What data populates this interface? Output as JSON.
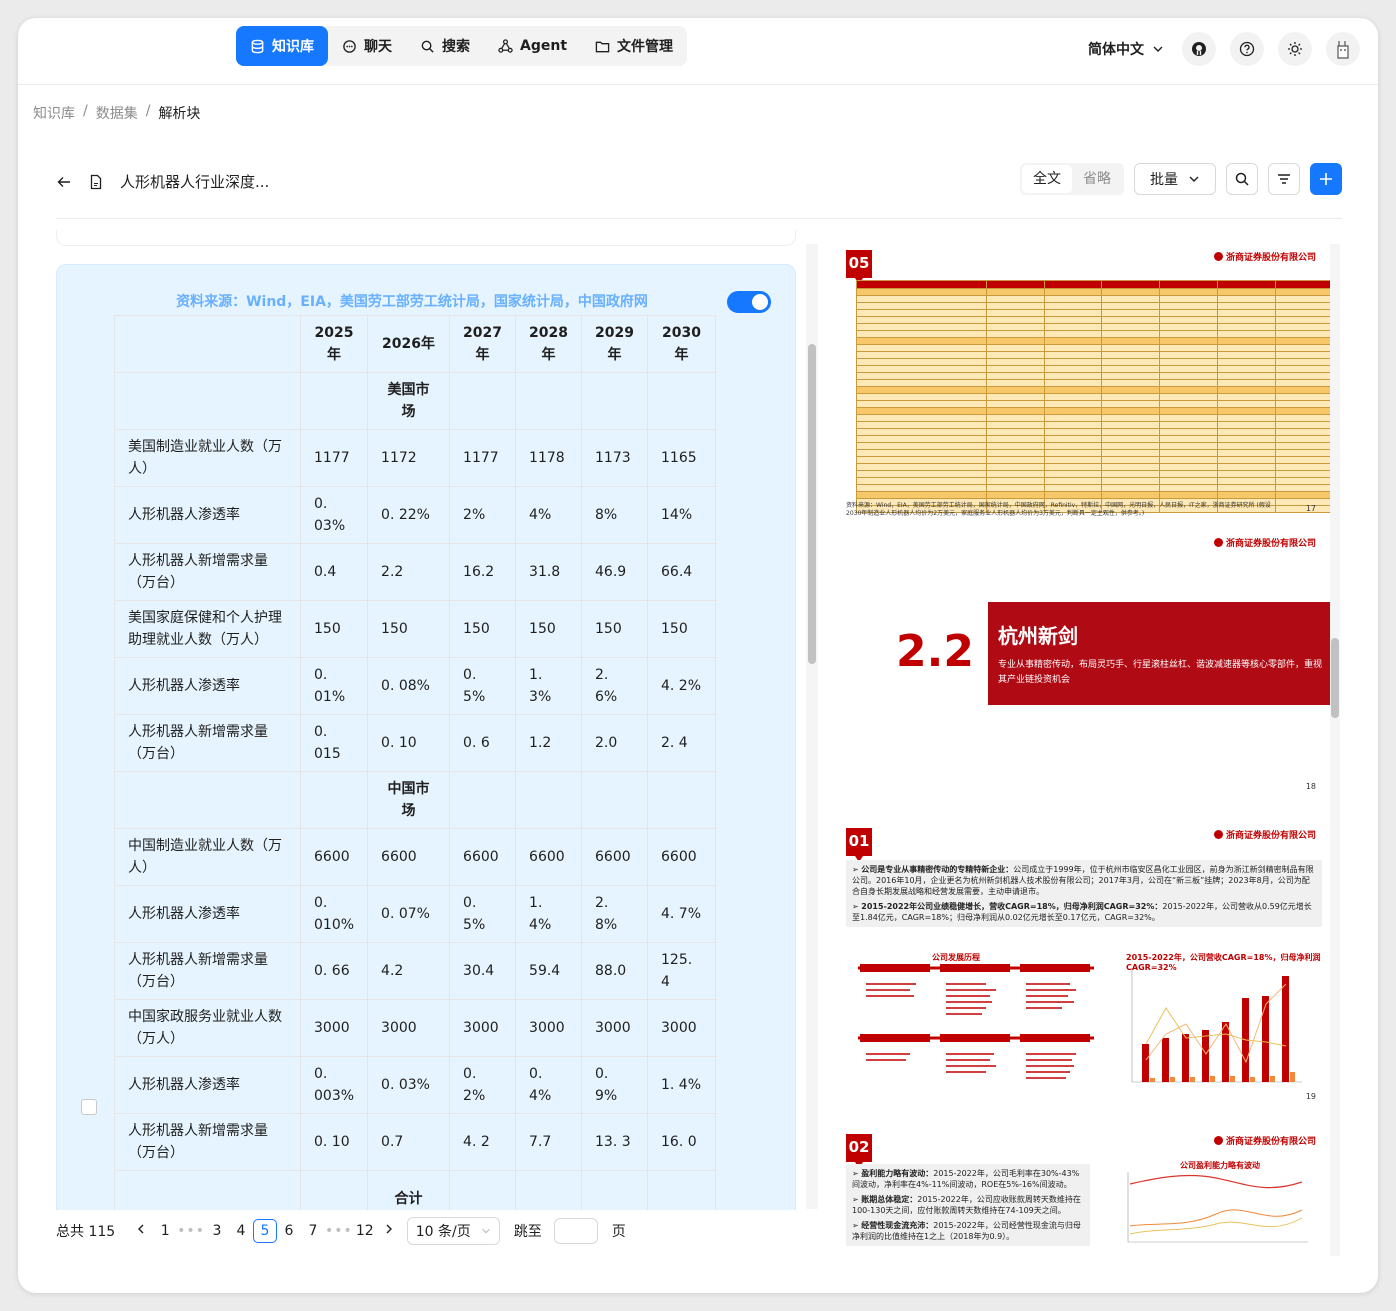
{
  "nav": {
    "items": [
      {
        "label": "知识库",
        "icon": "database-icon",
        "active": true
      },
      {
        "label": "聊天",
        "icon": "chat-icon",
        "active": false
      },
      {
        "label": "搜索",
        "icon": "search-icon",
        "active": false
      },
      {
        "label": "Agent",
        "icon": "agent-graph-icon",
        "active": false
      },
      {
        "label": "文件管理",
        "icon": "folder-icon",
        "active": false
      }
    ],
    "language": "简体中文"
  },
  "breadcrumb": [
    "知识库",
    "数据集",
    "解析块"
  ],
  "doc": {
    "title": "人形机器人行业深度...",
    "view_full": "全文",
    "view_brief": "省略",
    "batch_label": "批量"
  },
  "chunk": {
    "source": "资料来源：Wind，EIA，美国劳工部劳工统计局，国家统计局，中国政府网",
    "enabled": true,
    "headers": [
      "",
      "2025年",
      "2026年",
      "2027年",
      "2028年",
      "2029年",
      "2030年"
    ],
    "rows": [
      {
        "section": "美国市场"
      },
      {
        "cells": [
          "美国制造业就业人数（万人）",
          "1177",
          "1172",
          "1177",
          "1178",
          "1173",
          "1165"
        ]
      },
      {
        "cells": [
          "人形机器人渗透率",
          "0. 03%",
          "0. 22%",
          "2%",
          "4%",
          "8%",
          "14%"
        ]
      },
      {
        "cells": [
          "人形机器人新增需求量（万台）",
          "0.4",
          "2.2",
          "16.2",
          "31.8",
          "46.9",
          "66.4"
        ]
      },
      {
        "cells": [
          "美国家庭保健和个人护理助理就业人数（万人）",
          "150",
          "150",
          "150",
          "150",
          "150",
          "150"
        ]
      },
      {
        "cells": [
          "人形机器人渗透率",
          "0. 01%",
          "0. 08%",
          "0. 5%",
          "1. 3%",
          "2. 6%",
          "4. 2%"
        ]
      },
      {
        "cells": [
          "人形机器人新增需求量（万台）",
          "0. 015",
          "0. 10",
          "0. 6",
          "1.2",
          "2.0",
          "2. 4"
        ]
      },
      {
        "section": "中国市场"
      },
      {
        "cells": [
          "中国制造业就业人数（万人）",
          "6600",
          "6600",
          "6600",
          "6600",
          "6600",
          "6600"
        ]
      },
      {
        "cells": [
          "人形机器人渗透率",
          "0. 010%",
          "0. 07%",
          "0. 5%",
          "1. 4%",
          "2. 8%",
          "4. 7%"
        ]
      },
      {
        "cells": [
          "人形机器人新增需求量（万台）",
          "0. 66",
          "4.2",
          "30.4",
          "59.4",
          "88.0",
          "125. 4"
        ]
      },
      {
        "cells": [
          "中国家政服务业就业人数（万人）",
          "3000",
          "3000",
          "3000",
          "3000",
          "3000",
          "3000"
        ]
      },
      {
        "cells": [
          "人形机器人渗透率",
          "0. 003%",
          "0. 03%",
          "0. 2%",
          "0. 4%",
          "0. 9%",
          "1. 4%"
        ]
      },
      {
        "cells": [
          "人形机器人新增需求量（万台）",
          "0. 10",
          "0.7",
          "4. 2",
          "7.7",
          "13. 3",
          "16. 0"
        ]
      },
      {
        "section": "合计"
      }
    ]
  },
  "pagination": {
    "total": "总共 115",
    "pages": [
      "1",
      "•••",
      "3",
      "4",
      "5",
      "6",
      "7",
      "•••",
      "12"
    ],
    "current": "5",
    "page_size": "10 条/页",
    "jump_label": "跳至",
    "page_suffix": "页"
  },
  "pdf": {
    "brand": "浙商证券股份有限公司",
    "page17": {
      "num": "05",
      "footer": "17",
      "note": "资料来源：Wind，EIA，美国劳工部劳工统计局，国家统计局，中国政府网，Refinitiv，特斯拉，中国网，光明日报，人民日报，IT之家，浙商证券研究所 (假设2030年制造业人形机器人均价为2万美元，家庭服务业人形机器人均价为3万美元，判断具一定主观性，供参考。)"
    },
    "page18": {
      "sec": "2.2",
      "title": "杭州新剑",
      "desc": "专业从事精密传动，布局灵巧手、行星滚柱丝杠、谐波减速器等核心零部件，重视其产业链投资机会",
      "footer": "18"
    },
    "page19": {
      "num": "01",
      "footer": "19",
      "p1_bold": "公司是专业从事精密传动的专精特新企业：",
      "p1": "公司成立于1999年，位于杭州市临安区昌化工业园区，前身为浙江新剑精密制品有限公司。2016年10月，企业更名为杭州新剑机器人技术股份有限公司；2017年3月，公司在“新三板”挂牌；2023年8月，公司为配合自身长期发展战略和经营发展需要，主动申请退市。",
      "p2_bold": "2015-2022年公司业绩稳健增长，营收CAGR=18%，归母净利润CAGR=32%：",
      "p2": "2015-2022年，公司营收从0.59亿元增长至1.84亿元，CAGR=18%；归母净利润从0.02亿元增长至0.17亿元，CAGR=32%。",
      "chart1_title": "公司发展历程",
      "chart2_title": "2015-2022年，公司营收CAGR=18%，归母净利润CAGR=32%"
    },
    "page20": {
      "num": "02",
      "b1": "盈利能力略有波动：",
      "t1": "2015-2022年，公司毛利率在30%-43%间波动，净利率在4%-11%间波动，ROE在5%-16%间波动。",
      "b2": "账期总体稳定：",
      "t2": "2015-2022年，公司应收账款周转天数维持在100-130天之间，应付账款周转天数维持在74-109天之间。",
      "b3": "经营性现金流充沛：",
      "t3": "2015-2022年，公司经营性现金流与归母净利润的比值维持在1之上（2018年为0.9）。",
      "chart_title": "公司盈利能力略有波动"
    }
  }
}
